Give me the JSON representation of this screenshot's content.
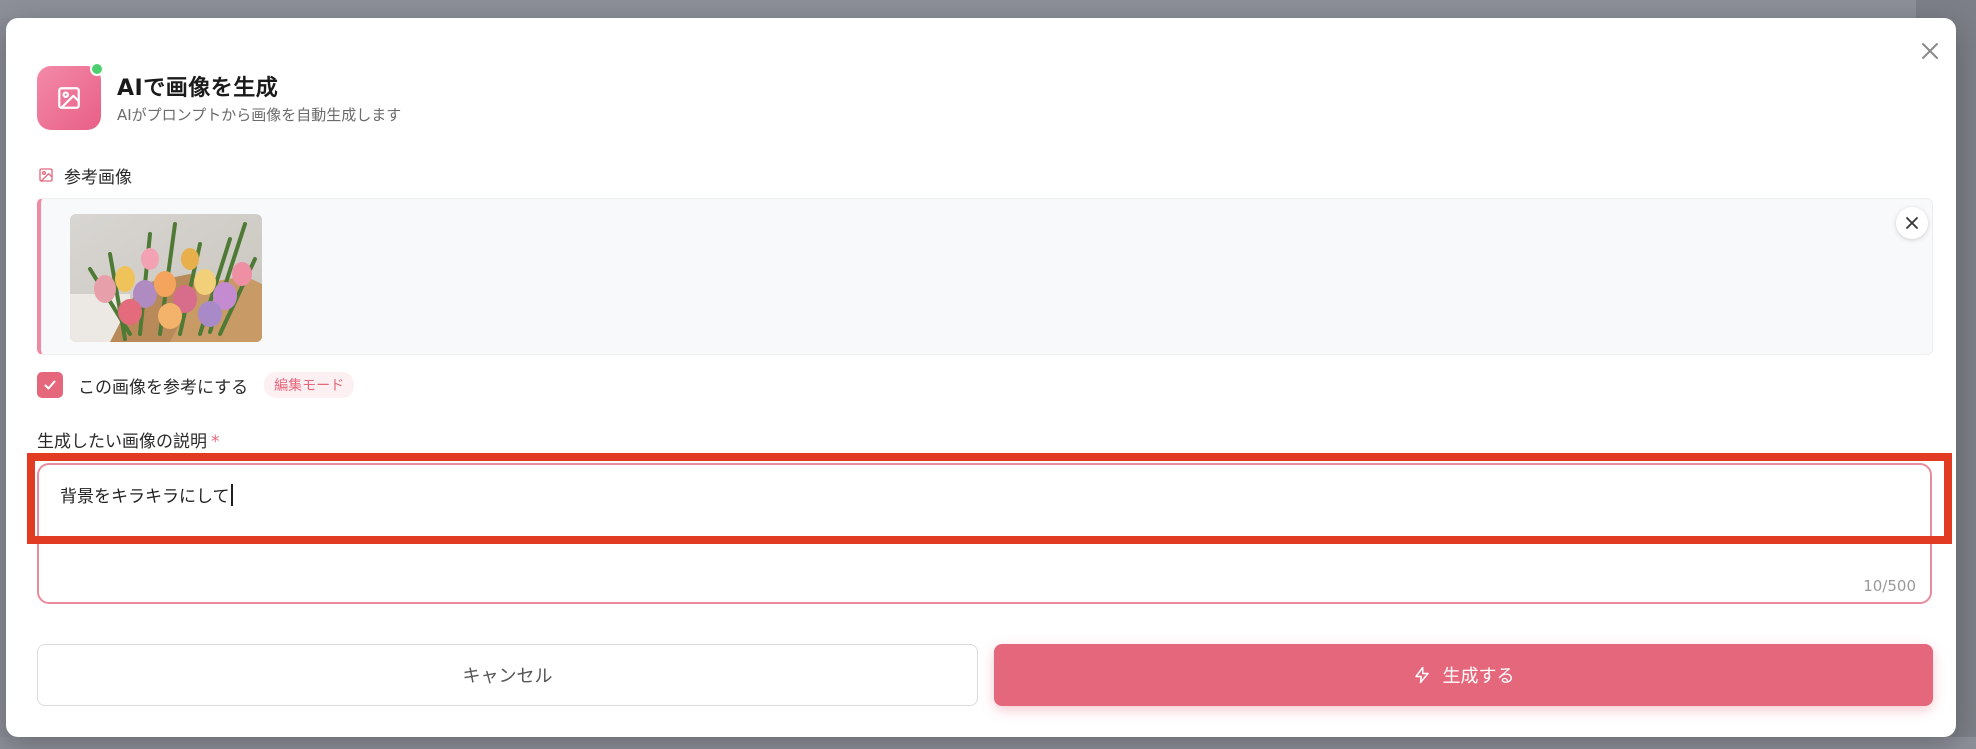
{
  "modal": {
    "title": "AIで画像を生成",
    "subtitle": "AIがプロンプトから画像を自動生成します"
  },
  "reference": {
    "label": "参考画像",
    "use_as_reference_label": "この画像を参考にする",
    "use_as_reference_checked": true,
    "mode_badge": "編集モード"
  },
  "description": {
    "label": "生成したい画像の説明",
    "required_mark": "*",
    "value": "背景をキラキラにして",
    "counter": "10/500"
  },
  "actions": {
    "cancel_label": "キャンセル",
    "generate_label": "生成する"
  },
  "colors": {
    "accent": "#e5677c",
    "status_online": "#4ccf6e",
    "highlight": "#e23b23"
  },
  "icons": {
    "header": "image-icon",
    "reference_label": "image-icon",
    "close": "close-icon",
    "remove_reference": "close-icon",
    "checkbox": "check-icon",
    "generate": "lightning-icon"
  }
}
